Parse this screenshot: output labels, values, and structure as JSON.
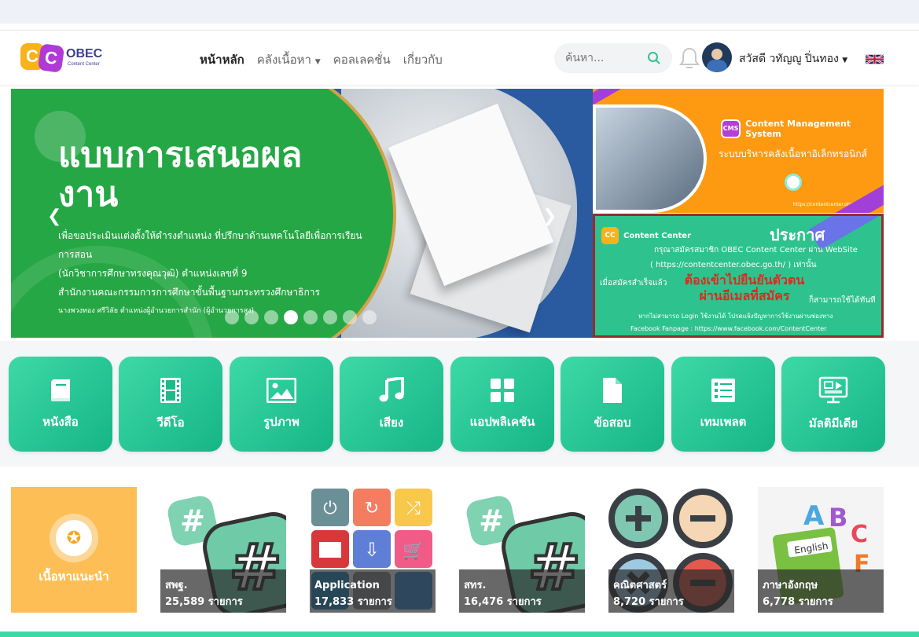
{
  "logo": {
    "letters": "CC",
    "brand": "OBEC",
    "tagline": "Content Center"
  },
  "menu": [
    {
      "label": "หน้าหลัก",
      "active": true
    },
    {
      "label": "คลังเนื้อหา",
      "dropdown": true
    },
    {
      "label": "คอลเลคชั่น"
    },
    {
      "label": "เกี่ยวกับ"
    }
  ],
  "search": {
    "placeholder": "ค้นหา..."
  },
  "user": {
    "name": "สวัสดี วทัญญู ปิ่นทอง"
  },
  "hero": {
    "title": "แบบการเสนอผลงาน",
    "desc": [
      "เพื่อขอประเมินแต่งตั้งให้ดำรงตำแหน่ง ที่ปรึกษาด้านเทคโนโลยีเพื่อการเรียนการสอน",
      "(นักวิชาการศึกษาทรงคุณวุฒิ) ตำแหน่งเลขที่ 9",
      "สำนักงานคณะกรรมการการศึกษาขั้นพื้นฐานกระทรวงศึกษาธิการ"
    ],
    "author": "นางพวงทอง ศรีวิลัย ตำแหน่งผู้อำนวยการสำนัก (ผู้อำนวยการสูง)",
    "slides": 8,
    "active_slide": 4
  },
  "banner_cms": {
    "badge": "CMS",
    "title": "Content Management System",
    "subtitle": "ระบบบริหารคลังเนื้อหาอิเล็กทรอนิกส์",
    "url": "https://contentcenter.obec.go.th/"
  },
  "banner_notice": {
    "badge": "CC",
    "brand": "Content Center",
    "heading": "ประกาศ",
    "line1": "กรุณาสมัครสมาชิก OBEC Content Center ผ่าน WebSite",
    "line2": "( https://contentcenter.obec.go.th/ ) เท่านั้น",
    "line3": "เมื่อสมัครสำเร็จแล้ว",
    "highlight1": "ต้องเข้าไปยืนยันตัวตน",
    "highlight2": "ผ่านอีเมลที่สมัคร",
    "line4": "ก็สามารถใช้ได้ทันที",
    "line5": "หากไม่สามารถ Login ใช้งานได้ โปรดแจ้งปัญหาการใช้งานผ่านช่องทาง",
    "line6": "Facebook Fanpage : https://www.facebook.com/ContentCenter"
  },
  "categories": [
    {
      "label": "หนังสือ",
      "icon": "book-icon"
    },
    {
      "label": "วีดีโอ",
      "icon": "film-icon"
    },
    {
      "label": "รูปภาพ",
      "icon": "image-icon"
    },
    {
      "label": "เสียง",
      "icon": "music-icon"
    },
    {
      "label": "แอปพลิเคชัน",
      "icon": "apps-icon"
    },
    {
      "label": "ข้อสอบ",
      "icon": "document-icon"
    },
    {
      "label": "เทมเพลต",
      "icon": "list-icon"
    },
    {
      "label": "มัลติมีเดีย",
      "icon": "multimedia-icon"
    }
  ],
  "featured": {
    "label": "เนื้อหาแนะนำ"
  },
  "collections": [
    {
      "name": "สพฐ.",
      "count": "25,589 รายการ"
    },
    {
      "name": "Application",
      "count": "17,833 รายการ"
    },
    {
      "name": "สทร.",
      "count": "16,476 รายการ"
    },
    {
      "name": "คณิตศาสตร์",
      "count": "8,720 รายการ"
    },
    {
      "name": "ภาษาอังกฤษ",
      "count": "6,778 รายการ"
    }
  ],
  "colors": {
    "accent": "#26c48f",
    "hero_green": "#26a745",
    "cms_orange": "#fd9a12",
    "featured": "#fdbf55"
  }
}
